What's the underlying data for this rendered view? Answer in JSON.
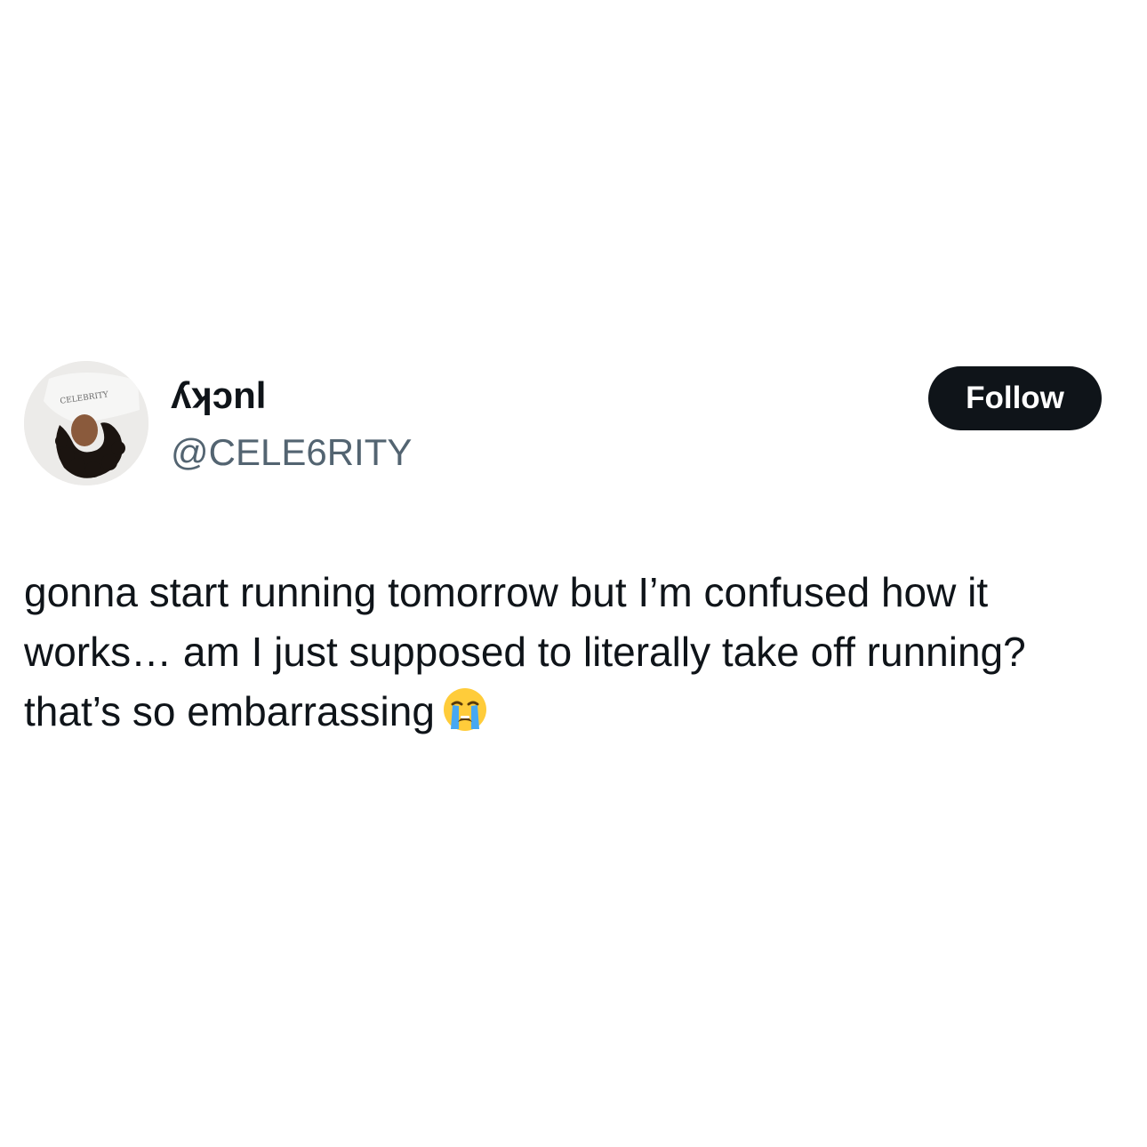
{
  "tweet": {
    "display_name": "ʎʞɔnl",
    "handle": "@CELE6RITY",
    "follow_label": "Follow",
    "text": "gonna start running tomorrow but I’m confused how it works… am I just supposed to literally take off running? that’s so embarrassing",
    "emoji_icon": "loudly-crying-face-icon",
    "avatar_shirt_text": "CELEBRITY"
  },
  "colors": {
    "background": "#ffffff",
    "text_primary": "#0f1419",
    "text_secondary": "#536471",
    "button_bg": "#0f1419",
    "button_text": "#ffffff"
  }
}
